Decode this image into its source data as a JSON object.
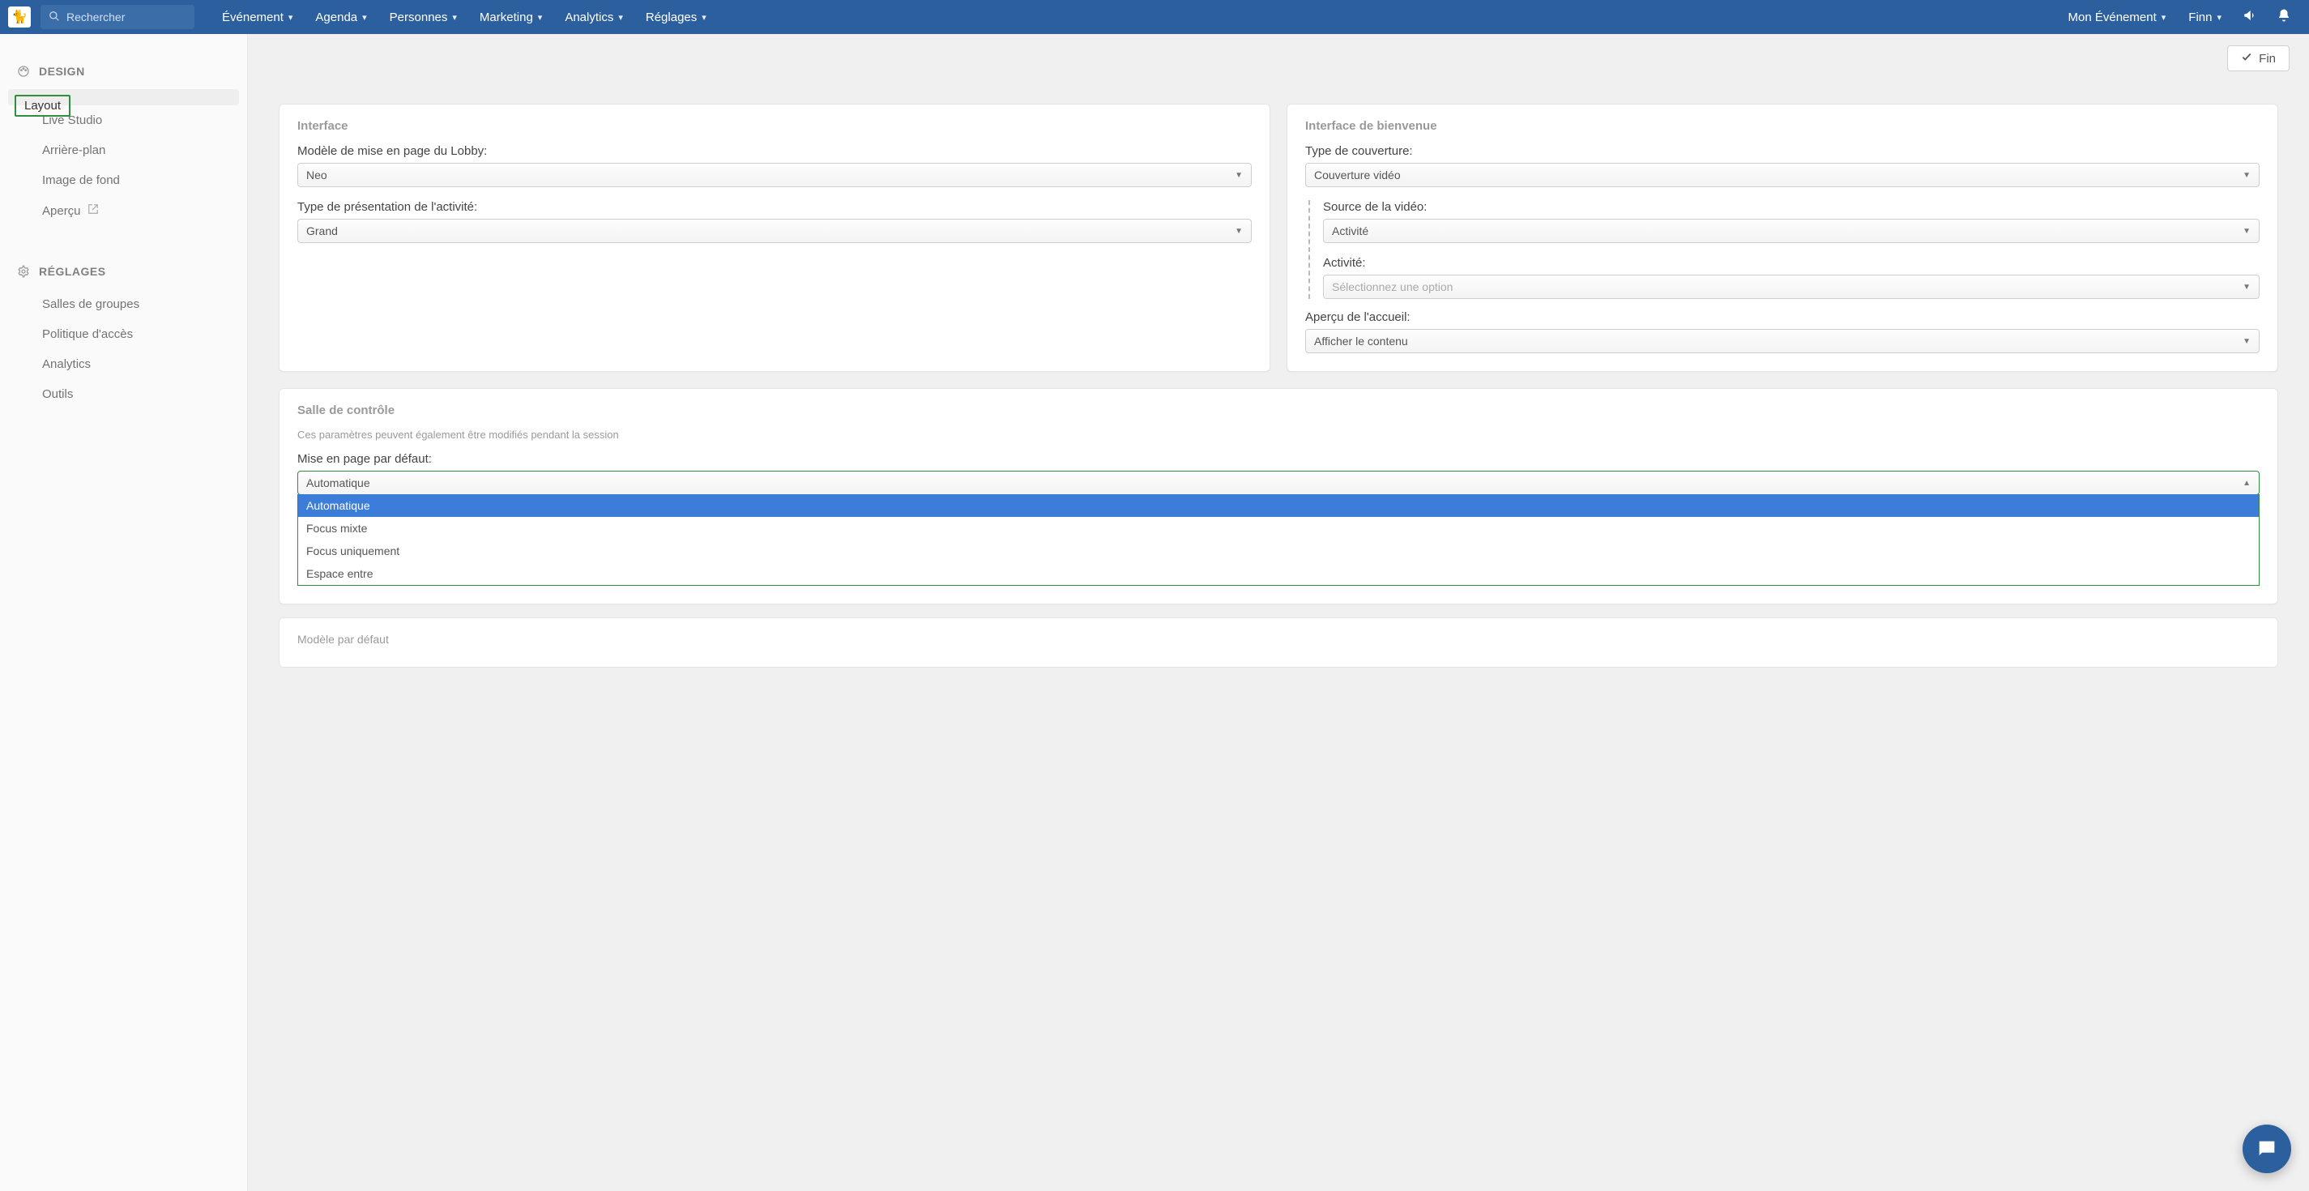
{
  "topbar": {
    "search_placeholder": "Rechercher",
    "nav": [
      {
        "label": "Événement"
      },
      {
        "label": "Agenda"
      },
      {
        "label": "Personnes"
      },
      {
        "label": "Marketing"
      },
      {
        "label": "Analytics"
      },
      {
        "label": "Réglages"
      }
    ],
    "right": {
      "event_label": "Mon Événement",
      "user_label": "Finn"
    }
  },
  "content_top": {
    "fin_label": "Fin"
  },
  "sidebar": {
    "groups": [
      {
        "title": "DESIGN",
        "items": [
          {
            "label": "Layout",
            "active": true
          },
          {
            "label": "Live Studio"
          },
          {
            "label": "Arrière-plan"
          },
          {
            "label": "Image de fond"
          },
          {
            "label": "Aperçu",
            "external": true
          }
        ]
      },
      {
        "title": "RÉGLAGES",
        "items": [
          {
            "label": "Salles de groupes"
          },
          {
            "label": "Politique d'accès"
          },
          {
            "label": "Analytics"
          },
          {
            "label": "Outils"
          }
        ]
      }
    ]
  },
  "panel_interface": {
    "title": "Interface",
    "lobby_layout_label": "Modèle de mise en page du Lobby:",
    "lobby_layout_value": "Neo",
    "activity_presentation_label": "Type de présentation de l'activité:",
    "activity_presentation_value": "Grand"
  },
  "panel_welcome": {
    "title": "Interface de bienvenue",
    "cover_type_label": "Type de couverture:",
    "cover_type_value": "Couverture vidéo",
    "video_source_label": "Source de la vidéo:",
    "video_source_value": "Activité",
    "activity_label": "Activité:",
    "activity_value": "Sélectionnez une option",
    "home_preview_label": "Aperçu de l'accueil:",
    "home_preview_value": "Afficher le contenu"
  },
  "panel_control": {
    "title": "Salle de contrôle",
    "subtitle": "Ces paramètres peuvent également être modifiés pendant la session",
    "default_layout_label": "Mise en page par défaut:",
    "default_layout_value": "Automatique",
    "options": [
      "Automatique",
      "Focus mixte",
      "Focus uniquement",
      "Espace entre"
    ]
  },
  "panel_ghost": {
    "label": "Modèle par défaut"
  }
}
